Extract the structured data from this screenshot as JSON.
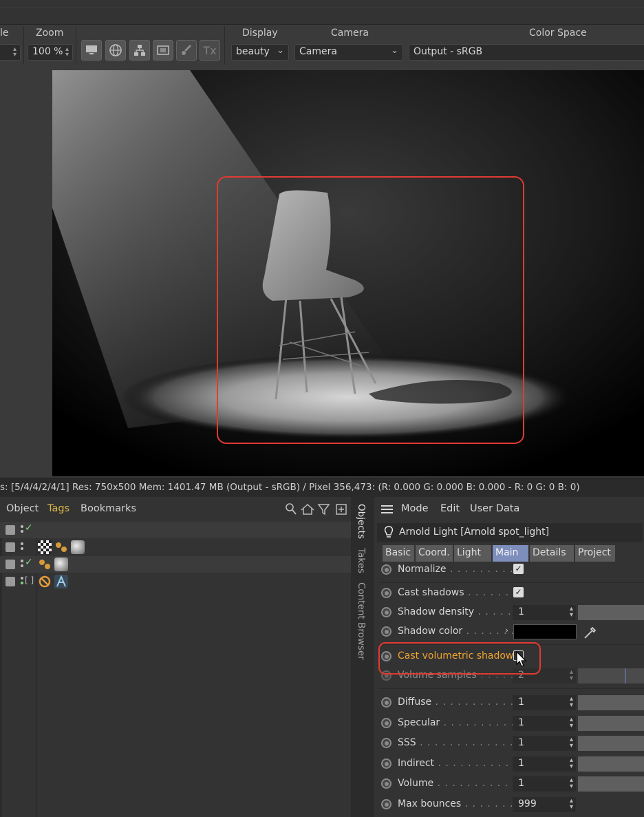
{
  "toolbar": {
    "scale_label": "le",
    "zoom_label": "Zoom",
    "zoom_value": "100 %",
    "display_label": "Display",
    "display_value": "beauty",
    "camera_label": "Camera",
    "camera_value": "Camera",
    "colorspace_label": "Color Space",
    "colorspace_value": "Output - sRGB",
    "buttons": [
      "monitor-icon",
      "globe-icon",
      "hierarchy-icon",
      "region-icon",
      "brush-icon",
      "tx-icon"
    ],
    "tx_label": "Tx"
  },
  "statusbar": {
    "text": "s: [5/4/4/2/4/1]  Res: 750x500  Mem: 1401.47 MB  (Output - sRGB) / Pixel 356,473: (R: 0.000 G: 0.000 B: 0.000 - R: 0 G: 0 B: 0)"
  },
  "object_manager": {
    "menu": [
      "Object",
      "Tags",
      "Bookmarks"
    ]
  },
  "side_tabs": [
    "Objects",
    "Takes",
    "Content Browser"
  ],
  "attributes": {
    "menu": [
      "Mode",
      "Edit",
      "User Data"
    ],
    "object_title": "Arnold Light [Arnold spot_light]",
    "tabs": [
      "Basic",
      "Coord.",
      "Light",
      "Main",
      "Details",
      "Project"
    ],
    "active_tab": "Main",
    "params": {
      "normalize": {
        "label": "Normalize",
        "leader": " . . . . . . . . . .",
        "checked": true
      },
      "cast_shadows": {
        "label": "Cast shadows",
        "leader": " . . . . . . . .",
        "checked": true
      },
      "shadow_density": {
        "label": "Shadow density",
        "leader": " . . . . . .",
        "value": "1"
      },
      "shadow_color": {
        "label": "Shadow color",
        "leader": " . . . . . . .",
        "color": "#000000"
      },
      "cast_volumetric_shadows": {
        "label": "Cast volumetric shadows",
        "checked": false
      },
      "volume_samples": {
        "label": "Volume samples",
        "leader": " . . . . .",
        "value": "2"
      },
      "diffuse": {
        "label": "Diffuse",
        "leader": " . . . . . . . . . . . . .",
        "value": "1"
      },
      "specular": {
        "label": "Specular",
        "leader": " . . . . . . . . . . .",
        "value": "1"
      },
      "sss": {
        "label": "SSS",
        "leader": " . . . . . . . . . . . . . . .",
        "value": "1"
      },
      "indirect": {
        "label": "Indirect",
        "leader": " . . . . . . . . . . .",
        "value": "1"
      },
      "volume": {
        "label": "Volume",
        "leader": " . . . . . . . . . . . .",
        "value": "1"
      },
      "max_bounces": {
        "label": "Max bounces",
        "leader": " . . . . . . . .",
        "value": "999"
      }
    }
  },
  "colors": {
    "highlight_red": "#e03a33",
    "label_orange": "#f0a432",
    "active_tab_blue": "#7d8ebc",
    "tags_gold": "#d9b84a"
  }
}
